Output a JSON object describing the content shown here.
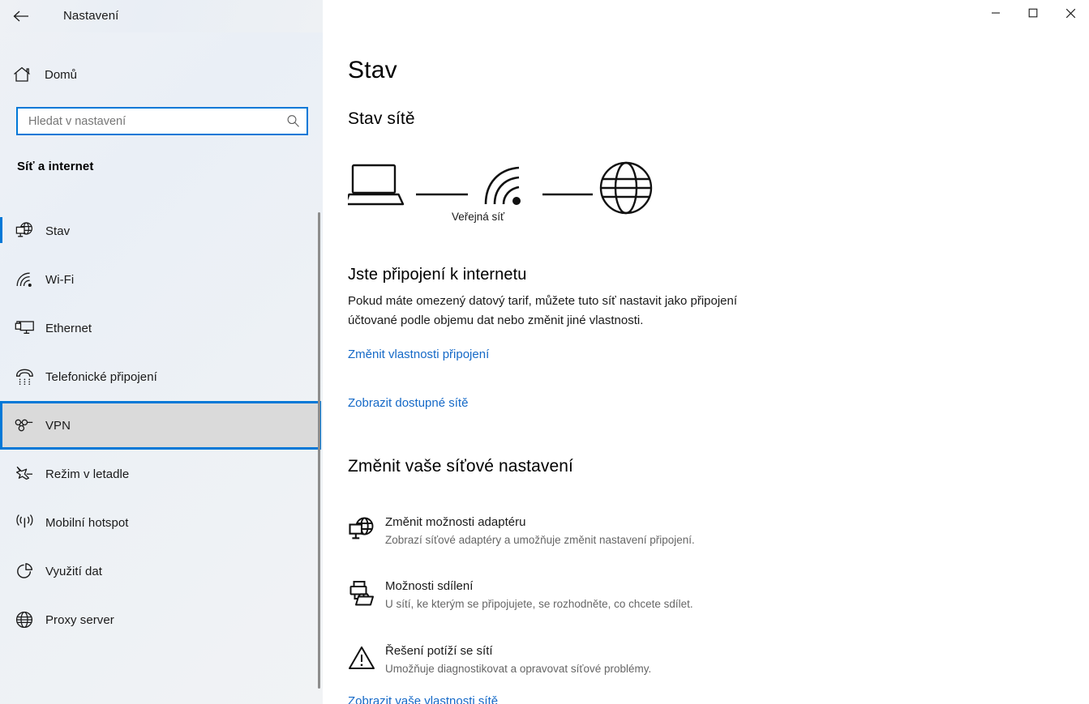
{
  "titlebar": {
    "back_label": "back-arrow",
    "title": "Nastavení",
    "minimize": "minimize",
    "maximize": "maximize",
    "close": "close"
  },
  "sidebar": {
    "home_label": "Domů",
    "search_placeholder": "Hledat v nastavení",
    "search_value": "",
    "section_title": "Síť a internet",
    "items": [
      {
        "label": "Stav",
        "icon": "status-globe-icon",
        "selected": true,
        "focused": false
      },
      {
        "label": "Wi-Fi",
        "icon": "wifi-icon",
        "selected": false,
        "focused": false
      },
      {
        "label": "Ethernet",
        "icon": "ethernet-icon",
        "selected": false,
        "focused": false
      },
      {
        "label": "Telefonické připojení",
        "icon": "dialup-phone-icon",
        "selected": false,
        "focused": false
      },
      {
        "label": "VPN",
        "icon": "vpn-icon",
        "selected": false,
        "focused": true
      },
      {
        "label": "Režim v letadle",
        "icon": "airplane-icon",
        "selected": false,
        "focused": false
      },
      {
        "label": "Mobilní hotspot",
        "icon": "hotspot-icon",
        "selected": false,
        "focused": false
      },
      {
        "label": "Využití dat",
        "icon": "data-usage-pie-icon",
        "selected": false,
        "focused": false
      },
      {
        "label": "Proxy server",
        "icon": "globe-icon",
        "selected": false,
        "focused": false
      }
    ]
  },
  "main": {
    "page_title": "Stav",
    "network_status_heading": "Stav sítě",
    "diagram": {
      "device_icon": "laptop-icon",
      "network_icon": "wifi-icon",
      "internet_icon": "globe-icon",
      "network_caption": "Veřejná síť"
    },
    "connection_status": "Jste připojení k internetu",
    "connection_description": "Pokud máte omezený datový tarif, můžete tuto síť nastavit jako připojení účtované podle objemu dat nebo změnit jiné vlastnosti.",
    "link_change_properties": "Změnit vlastnosti připojení",
    "link_show_networks": "Zobrazit dostupné sítě",
    "change_settings_heading": "Změnit vaše síťové nastavení",
    "settings": [
      {
        "icon": "adapter-globe-icon",
        "title": "Změnit možnosti adaptéru",
        "subtitle": "Zobrazí síťové adaptéry a umožňuje změnit nastavení připojení."
      },
      {
        "icon": "sharing-printer-icon",
        "title": "Možnosti sdílení",
        "subtitle": "U sítí, ke kterým se připojujete, se rozhodněte, co chcete sdílet."
      },
      {
        "icon": "troubleshoot-warning-icon",
        "title": "Řešení potíží se sítí",
        "subtitle": "Umožňuje diagnostikovat a opravovat síťové problémy."
      }
    ],
    "link_network_properties": "Zobrazit vaše vlastnosti sítě"
  },
  "colors": {
    "accent": "#0078d7",
    "link": "#1569c7",
    "text": "#1a1a1a",
    "subtext": "#666666"
  }
}
